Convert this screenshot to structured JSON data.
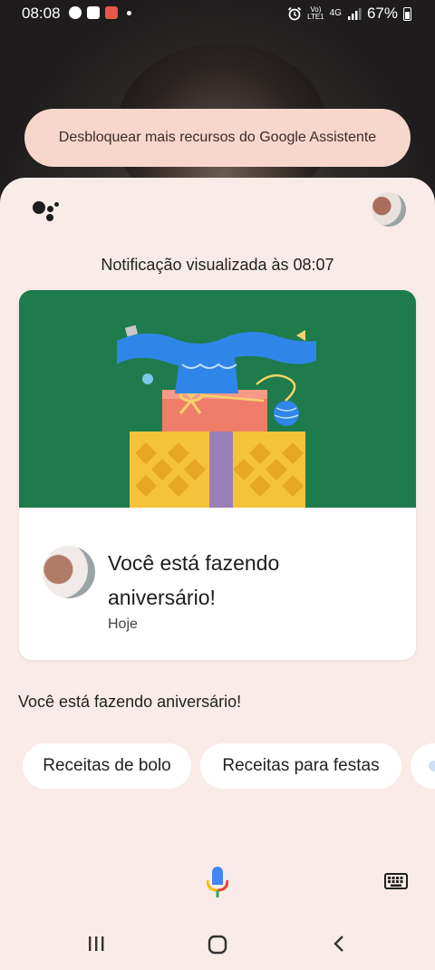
{
  "status_bar": {
    "time": "08:08",
    "network_top": "Vo)",
    "network_bottom": "LTE1",
    "network_type": "4G",
    "battery": "67%"
  },
  "unlock_prompt": {
    "label": "Desbloquear mais recursos do Google Assistente"
  },
  "assistant": {
    "notification_time": "Notificação visualizada às 08:07",
    "card": {
      "title": "Você está fazendo aniversário!",
      "subtitle": "Hoje"
    },
    "caption": "Você está fazendo aniversário!",
    "suggestions": [
      "Receitas de bolo",
      "Receitas para festas"
    ]
  },
  "colors": {
    "sheet_bg": "#f9ebe7",
    "banner_green": "#1e7b4b",
    "unlock_bg": "#f7d6cc"
  },
  "icons": {
    "status": [
      "facebook-icon",
      "outlook-icon",
      "app-icon",
      "alarm-icon",
      "signal-icon",
      "battery-icon"
    ],
    "bottom": [
      "mic-icon",
      "keyboard-icon"
    ],
    "nav": [
      "recents-icon",
      "home-icon",
      "back-icon"
    ]
  }
}
